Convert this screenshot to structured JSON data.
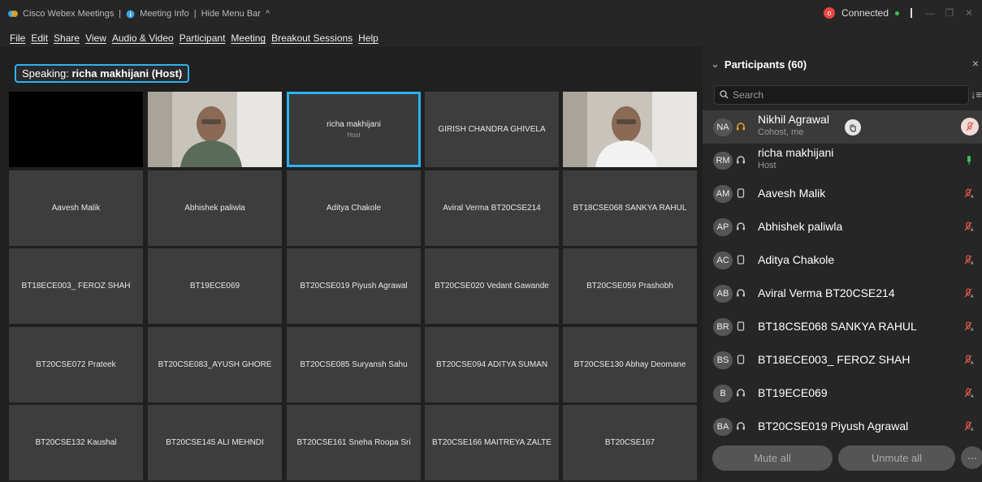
{
  "titlebar": {
    "app_name": "Cisco Webex Meetings",
    "meeting_info": "Meeting Info",
    "hide_menu": "Hide Menu Bar",
    "status": "Connected",
    "rec_label": "o"
  },
  "menu": [
    "File",
    "Edit",
    "Share",
    "View",
    "Audio & Video",
    "Participant",
    "Meeting",
    "Breakout Sessions",
    "Help"
  ],
  "speaking": {
    "prefix": "Speaking: ",
    "name": "richa makhijani (Host)"
  },
  "tiles": [
    {
      "label": "",
      "type": "black"
    },
    {
      "label": "",
      "type": "video"
    },
    {
      "label": "richa makhijani",
      "sub": "Host",
      "type": "host"
    },
    {
      "label": "GIRISH CHANDRA GHIVELA",
      "type": "name"
    },
    {
      "label": "",
      "type": "video"
    },
    {
      "label": "Aavesh Malik",
      "type": "name"
    },
    {
      "label": "Abhishek paliwla",
      "type": "name"
    },
    {
      "label": "Aditya Chakole",
      "type": "name"
    },
    {
      "label": "Aviral Verma BT20CSE214",
      "type": "name"
    },
    {
      "label": "BT18CSE068 SANKYA RAHUL",
      "type": "name"
    },
    {
      "label": "BT18ECE003_ FEROZ SHAH",
      "type": "name"
    },
    {
      "label": "BT19ECE069",
      "type": "name"
    },
    {
      "label": "BT20CSE019 Piyush Agrawal",
      "type": "name"
    },
    {
      "label": "BT20CSE020 Vedant Gawande",
      "type": "name"
    },
    {
      "label": "BT20CSE059 Prashobh",
      "type": "name"
    },
    {
      "label": "BT20CSE072 Prateek",
      "type": "name"
    },
    {
      "label": "BT20CSE083_AYUSH GHORE",
      "type": "name"
    },
    {
      "label": "BT20CSE085 Suryansh Sahu",
      "type": "name"
    },
    {
      "label": "BT20CSE094 ADITYA SUMAN",
      "type": "name"
    },
    {
      "label": "BT20CSE130 Abhay Deomane",
      "type": "name"
    },
    {
      "label": "BT20CSE132 Kaushal",
      "type": "name"
    },
    {
      "label": "BT20CSE145 ALI MEHNDI",
      "type": "name"
    },
    {
      "label": "BT20CSE161 Sneha Roopa Sri",
      "type": "name"
    },
    {
      "label": "BT20CSE166 MAITREYA ZALTE",
      "type": "name"
    },
    {
      "label": "BT20CSE167",
      "type": "name"
    }
  ],
  "panel": {
    "title": "Participants (60)",
    "search_placeholder": "Search",
    "participants": [
      {
        "initials": "NA",
        "name": "Nikhil Agrawal",
        "role": "Cohost, me",
        "device": "headset-orange",
        "hand": true,
        "mic": "muted-circle"
      },
      {
        "initials": "RM",
        "name": "richa makhijani",
        "role": "Host",
        "device": "headset",
        "mic": "on"
      },
      {
        "initials": "AM",
        "name": "Aavesh Malik",
        "device": "phone",
        "mic": "muted"
      },
      {
        "initials": "AP",
        "name": "Abhishek paliwla",
        "device": "headset",
        "mic": "muted"
      },
      {
        "initials": "AC",
        "name": "Aditya Chakole",
        "device": "phone",
        "mic": "muted"
      },
      {
        "initials": "AB",
        "name": "Aviral Verma BT20CSE214",
        "device": "headset",
        "mic": "muted"
      },
      {
        "initials": "BR",
        "name": "BT18CSE068 SANKYA RAHUL",
        "device": "phone",
        "mic": "muted"
      },
      {
        "initials": "BS",
        "name": "BT18ECE003_ FEROZ SHAH",
        "device": "phone",
        "mic": "muted"
      },
      {
        "initials": "B",
        "name": "BT19ECE069",
        "device": "headset",
        "mic": "muted"
      },
      {
        "initials": "BA",
        "name": "BT20CSE019 Piyush Agrawal",
        "device": "headset",
        "mic": "muted"
      }
    ],
    "mute_all": "Mute all",
    "unmute_all": "Unmute all",
    "more": "···"
  },
  "colors": {
    "accent": "#2ab4f5",
    "muted": "#e05a4a",
    "mic_on": "#3fbf5a",
    "headset_orange": "#f5a623"
  }
}
